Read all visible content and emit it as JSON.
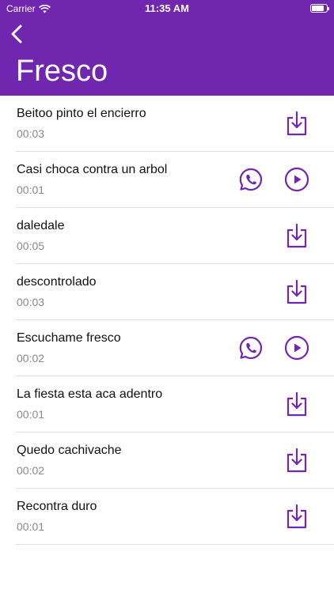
{
  "status_bar": {
    "carrier": "Carrier",
    "time": "11:35 AM",
    "battery_level": 0.85
  },
  "nav": {
    "back_icon": "chevron-left-icon",
    "title": "Fresco"
  },
  "colors": {
    "accent": "#7026ae",
    "text_primary": "#111111",
    "text_secondary": "#8a8a8a",
    "divider": "#dedede"
  },
  "items": [
    {
      "title": "Beitoo pinto el encierro",
      "duration": "00:03",
      "actions": [
        "download-icon"
      ]
    },
    {
      "title": "Casi choca contra un arbol",
      "duration": "00:01",
      "actions": [
        "whatsapp-icon",
        "play-icon"
      ]
    },
    {
      "title": "daledale",
      "duration": "00:05",
      "actions": [
        "download-icon"
      ]
    },
    {
      "title": "descontrolado",
      "duration": "00:03",
      "actions": [
        "download-icon"
      ]
    },
    {
      "title": "Escuchame fresco",
      "duration": "00:02",
      "actions": [
        "whatsapp-icon",
        "play-icon"
      ]
    },
    {
      "title": "La fiesta esta aca adentro",
      "duration": "00:01",
      "actions": [
        "download-icon"
      ]
    },
    {
      "title": "Quedo cachivache",
      "duration": "00:02",
      "actions": [
        "download-icon"
      ]
    },
    {
      "title": "Recontra duro",
      "duration": "00:01",
      "actions": [
        "download-icon"
      ]
    }
  ]
}
